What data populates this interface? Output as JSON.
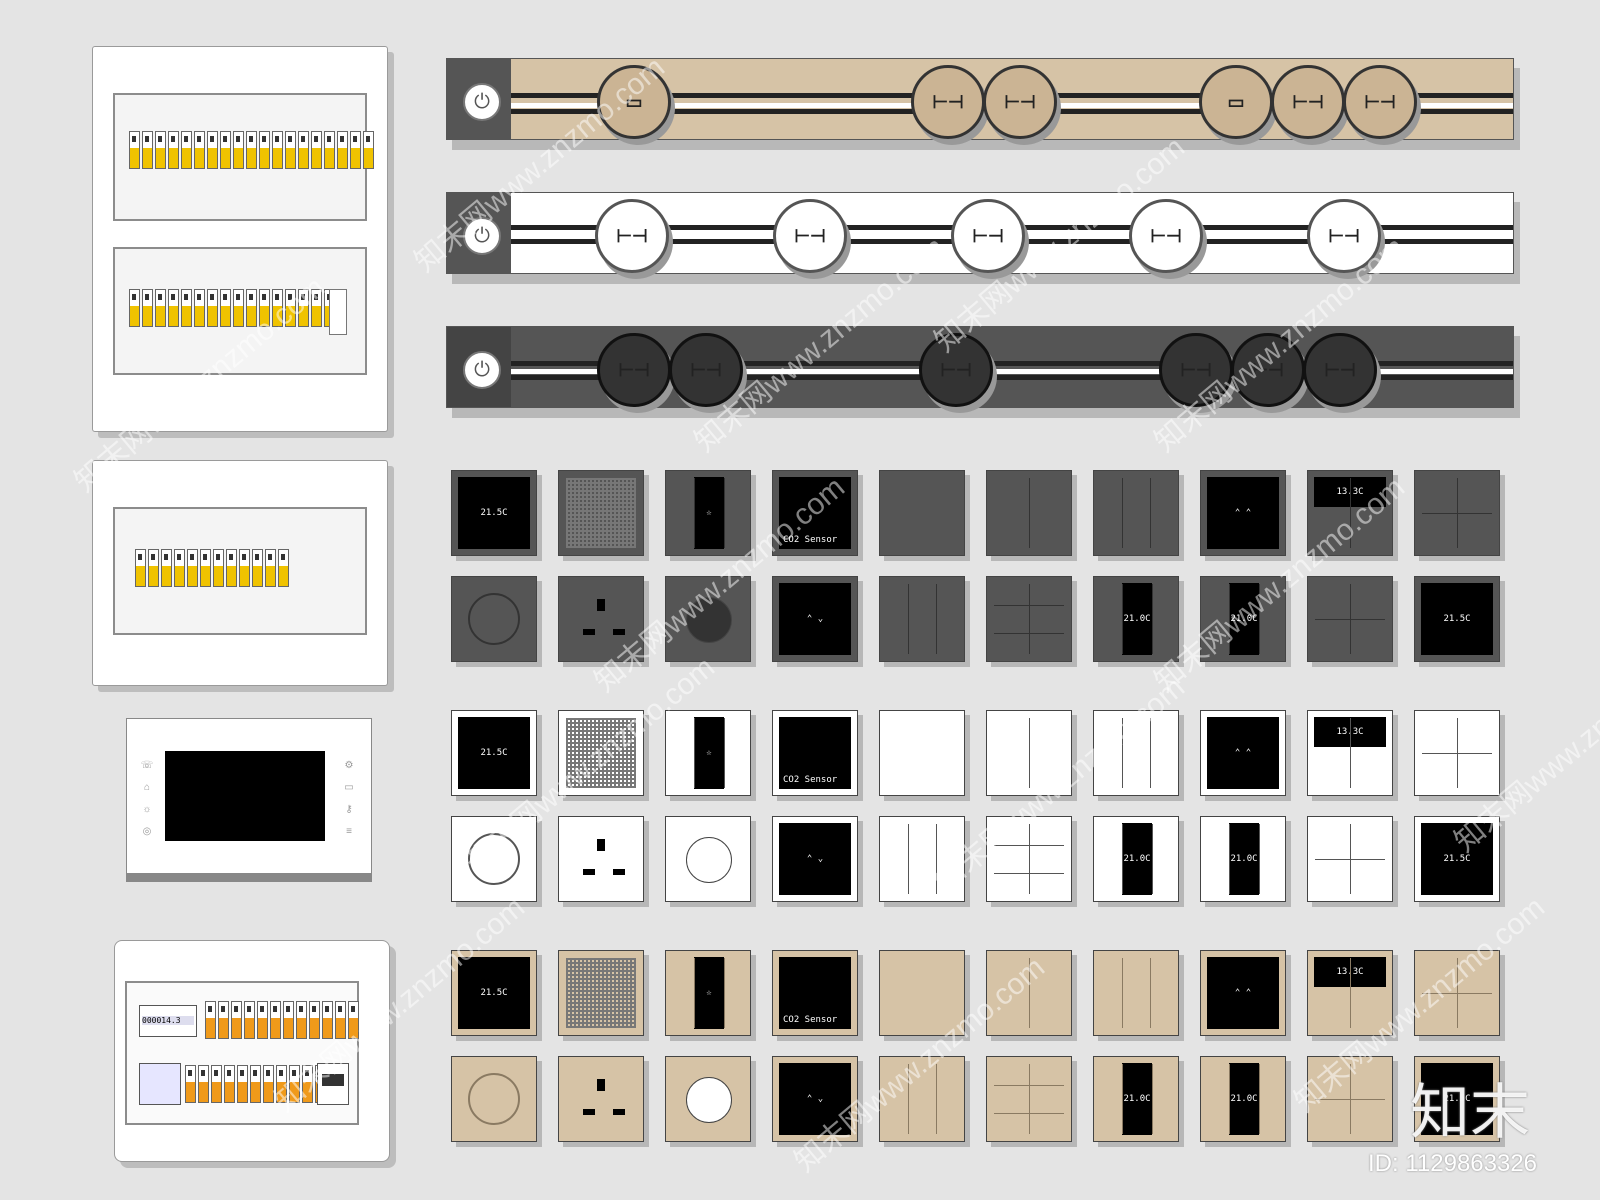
{
  "colors": {
    "background": "#e4e4e4",
    "dark": "#555555",
    "beige": "#d6c3a6",
    "black": "#000000",
    "white": "#ffffff",
    "breaker_yellow": "#f0c300"
  },
  "track_panels": {
    "power_icon": "power-icon",
    "socket_glyph": "⊢⊣",
    "usb_glyph": "▭"
  },
  "thermostat": {
    "temp1": "21.5C",
    "temp2": "21.0C",
    "readout": "13.3C"
  },
  "sensor": {
    "label": "CO2 Sensor"
  },
  "intercom": {
    "icons": [
      "phone-icon",
      "door-icon",
      "light-icon",
      "camera-icon",
      "settings-icon",
      "monitor-icon"
    ]
  },
  "meter": {
    "reading": "000014.3"
  },
  "logo": {
    "text": "知末"
  },
  "footer": {
    "id_text": "ID: 1129863326"
  },
  "watermark": {
    "text": "知末网www.znzmo.com"
  }
}
